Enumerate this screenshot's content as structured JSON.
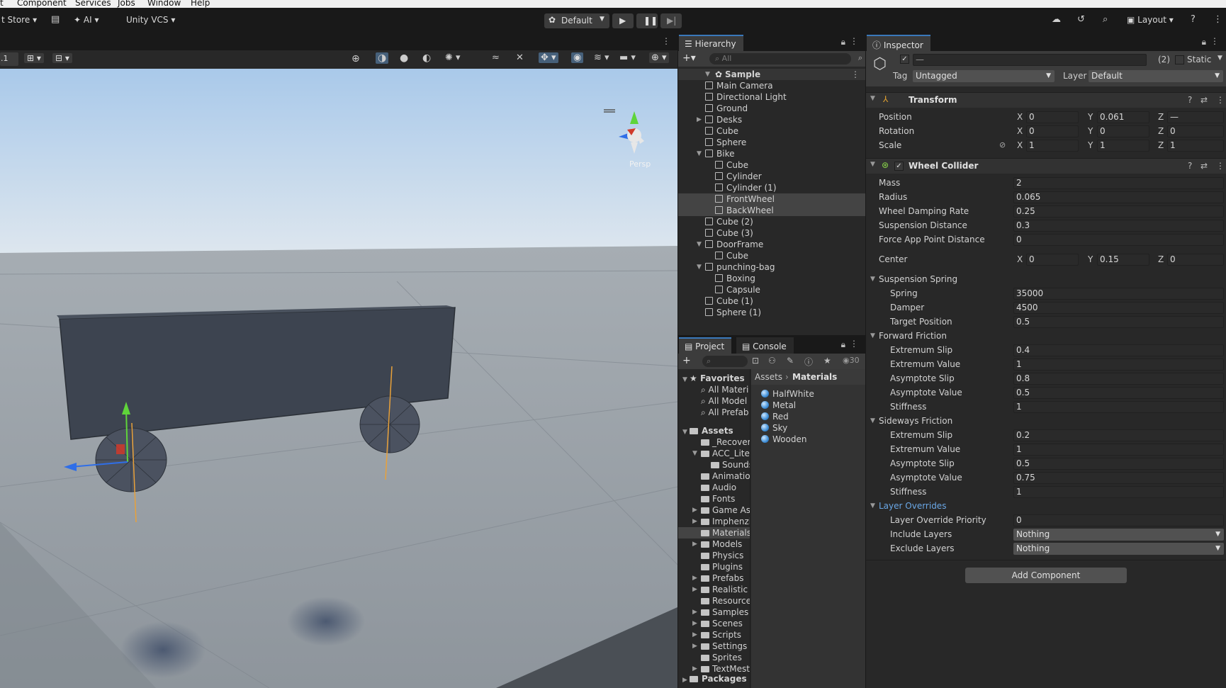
{
  "menu": {
    "items": [
      "t",
      "Component",
      "Services",
      "Jobs",
      "Window",
      "Help"
    ]
  },
  "toolbar": {
    "asset_store": "t Store",
    "ai": "AI",
    "vcs": "Unity VCS",
    "play_mode_profile": "Default",
    "layout": "Layout"
  },
  "scene": {
    "zoom": ".1",
    "gizmo_label": "Persp",
    "colors": {
      "sky_top": "#a9c9ea",
      "sky_horizon": "#dde6ee",
      "ground": "#8e959c",
      "box": "#3d4450"
    }
  },
  "hierarchy": {
    "tab": "Hierarchy",
    "search_placeholder": "All",
    "scene_name": "Sample",
    "items": [
      {
        "label": "Main Camera",
        "depth": 1
      },
      {
        "label": "Directional Light",
        "depth": 1
      },
      {
        "label": "Ground",
        "depth": 1
      },
      {
        "label": "Desks",
        "depth": 1,
        "expand": "collapsed"
      },
      {
        "label": "Cube",
        "depth": 1
      },
      {
        "label": "Sphere",
        "depth": 1
      },
      {
        "label": "Bike",
        "depth": 1,
        "expand": "expanded"
      },
      {
        "label": "Cube",
        "depth": 2
      },
      {
        "label": "Cylinder",
        "depth": 2
      },
      {
        "label": "Cylinder (1)",
        "depth": 2
      },
      {
        "label": "FrontWheel",
        "depth": 2,
        "selected": true
      },
      {
        "label": "BackWheel",
        "depth": 2,
        "selected": true
      },
      {
        "label": "Cube (2)",
        "depth": 1
      },
      {
        "label": "Cube (3)",
        "depth": 1
      },
      {
        "label": "DoorFrame",
        "depth": 1,
        "expand": "expanded"
      },
      {
        "label": "Cube",
        "depth": 2
      },
      {
        "label": "punching-bag",
        "depth": 1,
        "expand": "expanded"
      },
      {
        "label": "Boxing",
        "depth": 2
      },
      {
        "label": "Capsule",
        "depth": 2
      },
      {
        "label": "Cube (1)",
        "depth": 1
      },
      {
        "label": "Sphere (1)",
        "depth": 1
      }
    ]
  },
  "project": {
    "tabs": [
      "Project",
      "Console"
    ],
    "count": "30",
    "favorites": {
      "label": "Favorites",
      "items": [
        "All Materi",
        "All Model",
        "All Prefab"
      ]
    },
    "assets": {
      "label": "Assets",
      "folders": [
        {
          "label": "_Recover",
          "depth": 1
        },
        {
          "label": "ACC_Lite",
          "depth": 1,
          "expand": "expanded"
        },
        {
          "label": "Sounds",
          "depth": 2
        },
        {
          "label": "Animatio",
          "depth": 1
        },
        {
          "label": "Audio",
          "depth": 1
        },
        {
          "label": "Fonts",
          "depth": 1
        },
        {
          "label": "Game As",
          "depth": 1,
          "expand": "collapsed"
        },
        {
          "label": "Imphenzi",
          "depth": 1,
          "expand": "collapsed"
        },
        {
          "label": "Materials",
          "depth": 1,
          "selected": true
        },
        {
          "label": "Models",
          "depth": 1,
          "expand": "collapsed"
        },
        {
          "label": "Physics",
          "depth": 1
        },
        {
          "label": "Plugins",
          "depth": 1
        },
        {
          "label": "Prefabs",
          "depth": 1,
          "expand": "collapsed"
        },
        {
          "label": "Realistic (",
          "depth": 1,
          "expand": "collapsed"
        },
        {
          "label": "Resource",
          "depth": 1
        },
        {
          "label": "Samples",
          "depth": 1,
          "expand": "collapsed"
        },
        {
          "label": "Scenes",
          "depth": 1,
          "expand": "collapsed"
        },
        {
          "label": "Scripts",
          "depth": 1,
          "expand": "collapsed"
        },
        {
          "label": "Settings",
          "depth": 1,
          "expand": "collapsed"
        },
        {
          "label": "Sprites",
          "depth": 1
        },
        {
          "label": "TextMest",
          "depth": 1,
          "expand": "collapsed"
        }
      ]
    },
    "packages": "Packages",
    "breadcrumb": [
      "Assets",
      "Materials"
    ],
    "materials": [
      "HalfWhite",
      "Metal",
      "Red",
      "Sky",
      "Wooden"
    ]
  },
  "inspector": {
    "tab": "Inspector",
    "name_field": "—",
    "count": "(2)",
    "static_label": "Static",
    "tag_label": "Tag",
    "tag_value": "Untagged",
    "layer_label": "Layer",
    "layer_value": "Default",
    "transform": {
      "title": "Transform",
      "rows": [
        {
          "label": "Position",
          "x": "0",
          "y": "0.061",
          "z": "—"
        },
        {
          "label": "Rotation",
          "x": "0",
          "y": "0",
          "z": "0"
        },
        {
          "label": "Scale",
          "x": "1",
          "y": "1",
          "z": "1"
        }
      ]
    },
    "wheel_collider": {
      "title": "Wheel Collider",
      "fields": [
        {
          "label": "Mass",
          "value": "2"
        },
        {
          "label": "Radius",
          "value": "0.065"
        },
        {
          "label": "Wheel Damping Rate",
          "value": "0.25"
        },
        {
          "label": "Suspension Distance",
          "value": "0.3"
        },
        {
          "label": "Force App Point Distance",
          "value": "0"
        }
      ],
      "center": {
        "label": "Center",
        "x": "0",
        "y": "0.15",
        "z": "0"
      },
      "suspension_spring": {
        "title": "Suspension Spring",
        "fields": [
          {
            "label": "Spring",
            "value": "35000"
          },
          {
            "label": "Damper",
            "value": "4500"
          },
          {
            "label": "Target Position",
            "value": "0.5"
          }
        ]
      },
      "forward_friction": {
        "title": "Forward Friction",
        "fields": [
          {
            "label": "Extremum Slip",
            "value": "0.4"
          },
          {
            "label": "Extremum Value",
            "value": "1"
          },
          {
            "label": "Asymptote Slip",
            "value": "0.8"
          },
          {
            "label": "Asymptote Value",
            "value": "0.5"
          },
          {
            "label": "Stiffness",
            "value": "1"
          }
        ]
      },
      "sideways_friction": {
        "title": "Sideways Friction",
        "fields": [
          {
            "label": "Extremum Slip",
            "value": "0.2"
          },
          {
            "label": "Extremum Value",
            "value": "1"
          },
          {
            "label": "Asymptote Slip",
            "value": "0.5"
          },
          {
            "label": "Asymptote Value",
            "value": "0.75"
          },
          {
            "label": "Stiffness",
            "value": "1"
          }
        ]
      },
      "layer_overrides": {
        "title": "Layer Overrides",
        "priority_label": "Layer Override Priority",
        "priority_value": "0",
        "include_label": "Include Layers",
        "include_value": "Nothing",
        "exclude_label": "Exclude Layers",
        "exclude_value": "Nothing"
      }
    },
    "add_component": "Add Component"
  }
}
